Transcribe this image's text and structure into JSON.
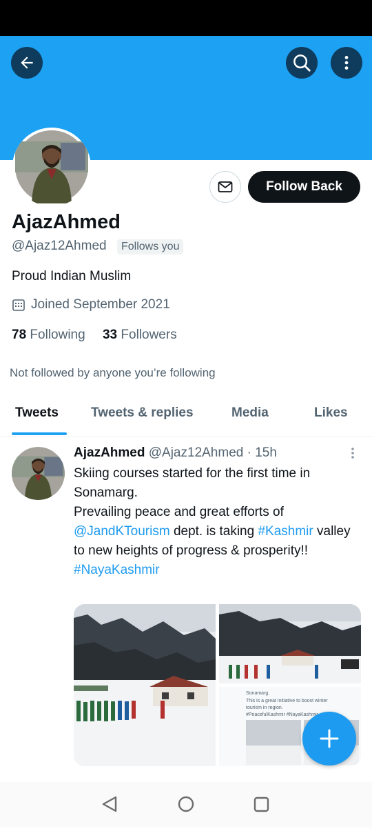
{
  "header": {
    "back_icon": "arrow-left-icon",
    "search_icon": "search-icon",
    "more_icon": "more-vertical-icon"
  },
  "profile": {
    "name": "AjazAhmed",
    "handle": "@Ajaz12Ahmed",
    "follows_you": "Follows you",
    "bio": "Proud Indian Muslim",
    "joined": "Joined September 2021",
    "following_count": "78",
    "following_label": "Following",
    "followers_count": "33",
    "followers_label": "Followers",
    "not_followed": "Not followed by anyone you’re following",
    "follow_back_label": "Follow Back"
  },
  "tabs": [
    {
      "label": "Tweets",
      "active": true
    },
    {
      "label": "Tweets & replies",
      "active": false
    },
    {
      "label": "Media",
      "active": false
    },
    {
      "label": "Likes",
      "active": false
    }
  ],
  "tweet": {
    "author": "AjazAhmed",
    "handle": "@Ajaz12Ahmed",
    "separator": "·",
    "time": "15h",
    "line1": "Skiing courses started for the first time in Sonamarg.",
    "line2_pre": "Prevailing peace and great efforts of ",
    "mention": "@JandKTourism",
    "line2_mid": " dept. is taking ",
    "hashtag1": "#Kashmir",
    "line2_post": " valley to new heights of progress & prosperity!!",
    "hashtag2": "#NayaKashmir",
    "embedded_text_1": "Sonamarg.",
    "embedded_text_2": "This is a great initiative to boost winter",
    "embedded_text_3": "tourism in region.",
    "embedded_text_4": "#PeacefulKashmir #NayaKashmir"
  },
  "colors": {
    "banner": "#1da1f2",
    "accent": "#1d9bf0",
    "text": "#0f1419",
    "secondary": "#536471"
  }
}
